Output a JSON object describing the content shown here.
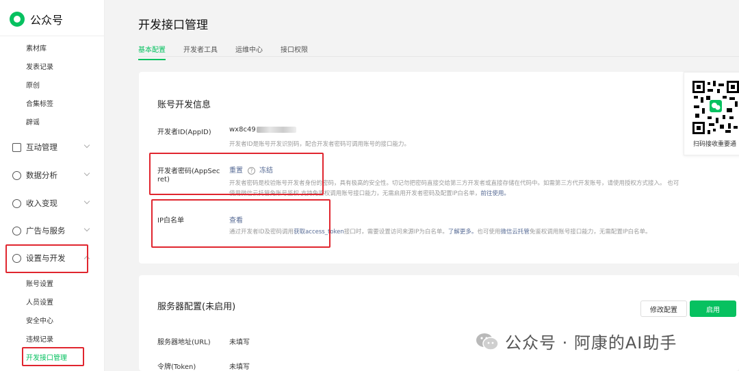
{
  "sidebar": {
    "logo_text": "公众号",
    "top_items": [
      "素材库",
      "发表记录",
      "原创",
      "合集标签",
      "辟谣"
    ],
    "groups": [
      "互动管理",
      "数据分析",
      "收入变现",
      "广告与服务",
      "设置与开发"
    ],
    "settings_items": [
      "账号设置",
      "人员设置",
      "安全中心",
      "违规记录",
      "开发接口管理"
    ]
  },
  "page": {
    "title": "开发接口管理",
    "tabs": [
      "基本配置",
      "开发者工具",
      "运维中心",
      "接口权限"
    ]
  },
  "account_info": {
    "title": "账号开发信息",
    "appid_label": "开发者ID(AppID)",
    "appid_value": "wx8c49",
    "appid_desc": "开发者ID是账号开发识别码，配合开发者密码可调用账号的接口能力。",
    "secret_label_1": "开发者密码(AppSec",
    "secret_label_2": "ret)",
    "secret_reset": "重置",
    "secret_freeze": "冻结",
    "secret_desc_1": "开发者密码是校验账号开发者身份的密码，具有极高的安全性。切记勿把密码直接交给第三方开发者或直接存储在代码中。如需第三方代开发账号，请使用授权方式接入。 也可",
    "secret_desc_2a": "使用微信云托管免账号鉴权",
    "secret_desc_2b": "支持免鉴权调用账号接口能力，无需启用开发者密码及配置IP白名单，",
    "secret_desc_2c": "前往使用。",
    "ip_label": "IP白名单",
    "ip_view": "查看",
    "ip_desc_a": "通过开发者ID及密码调用",
    "ip_desc_b": "获取access_token",
    "ip_desc_c": "接口时，需要设置访问来源IP为白名单。",
    "ip_desc_d": "了解更多。",
    "ip_desc_e": "也可使用",
    "ip_desc_f": "微信云托管",
    "ip_desc_g": "免鉴权调用账号接口能力，无需配置IP白名单。"
  },
  "qr": {
    "caption": "扫码接收重要通"
  },
  "server": {
    "title": "服务器配置(未启用)",
    "modify": "修改配置",
    "enable": "启用",
    "url_label": "服务器地址(URL)",
    "url_value": "未填写",
    "token_label": "令牌(Token)",
    "token_value": "未填写"
  },
  "watermark": {
    "text": "公众号 · 阿康的AI助手"
  },
  "colors": {
    "brand": "#07c160",
    "link": "#576b95",
    "highlight": "#e0252e"
  }
}
